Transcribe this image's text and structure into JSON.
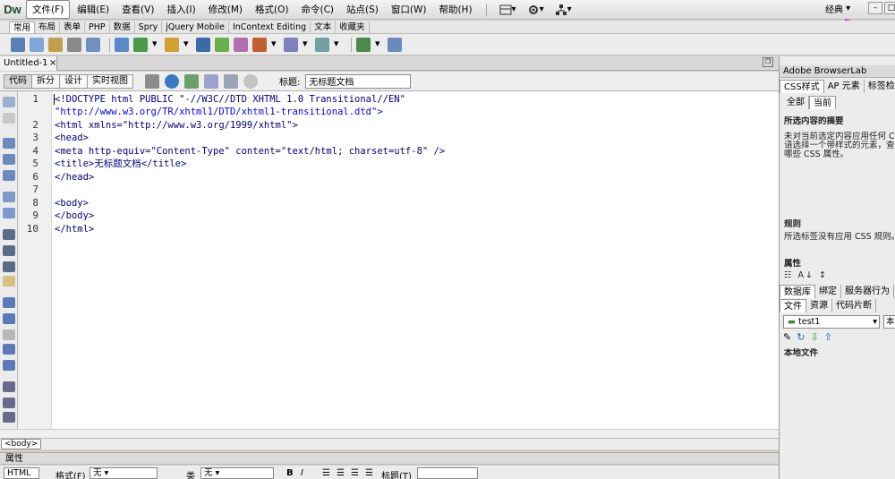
{
  "app": {
    "logo": "Dw",
    "workspace_label": "经典",
    "menu": [
      "文件(F)",
      "编辑(E)",
      "查看(V)",
      "插入(I)",
      "修改(M)",
      "格式(O)",
      "命令(C)",
      "站点(S)",
      "窗口(W)",
      "帮助(H)"
    ]
  },
  "insert_bar": {
    "tabs": [
      "常用",
      "布局",
      "表单",
      "PHP",
      "数据",
      "Spry",
      "jQuery Mobile",
      "InContext Editing",
      "文本",
      "收藏夹"
    ],
    "active_tab": "常用"
  },
  "document": {
    "tab_label": "Untitled-1",
    "close_glyph": "×",
    "view_buttons": [
      "代码",
      "拆分",
      "设计",
      "实时视图"
    ],
    "active_view": "代码",
    "title_label": "标题:",
    "title_value": "无标题文档",
    "line_numbers": [
      "1",
      "",
      "2",
      "3",
      "4",
      "5",
      "6",
      "7",
      "8",
      "9",
      "10"
    ],
    "status_tag": "<body>"
  },
  "code_lines": [
    "<!DOCTYPE html PUBLIC \"-//W3C//DTD XHTML 1.0 Transitional//EN\"",
    "\"http://www.w3.org/TR/xhtml1/DTD/xhtml1-transitional.dtd\">",
    "<html xmlns=\"http://www.w3.org/1999/xhtml\">",
    "<head>",
    "<meta http-equiv=\"Content-Type\" content=\"text/html; charset=utf-8\" />",
    "<title>无标题文档</title>",
    "</head>",
    "",
    "<body>",
    "</body>",
    "</html>"
  ],
  "properties": {
    "header": "属性",
    "html_btn": "HTML",
    "format_label": "格式(F)",
    "format_value": "无",
    "class_label": "类",
    "class_value": "无",
    "bold": "B",
    "italic": "I",
    "title_label": "标题(T)"
  },
  "right_panel": {
    "browserlab": "Adobe BrowserLab",
    "css_tabs": [
      "CSS样式",
      "AP 元素",
      "标签检查器"
    ],
    "css_subtabs": [
      "全部",
      "当前"
    ],
    "summary_title": "所选内容的摘要",
    "summary_lines": [
      "未对当前选定内容应用任何 CSS",
      "请选择一个带样式的元素，查看",
      "哪些 CSS 属性。"
    ],
    "rules_title": "规则",
    "rules_text": "所选标签没有应用 CSS 规则。",
    "props_title": "属性",
    "db_tabs": [
      "数据库",
      "绑定",
      "服务器行为"
    ],
    "file_tabs": [
      "文件",
      "资源",
      "代码片断"
    ],
    "site_value": "test1",
    "local_label": "本",
    "local_files": "本地文件"
  }
}
